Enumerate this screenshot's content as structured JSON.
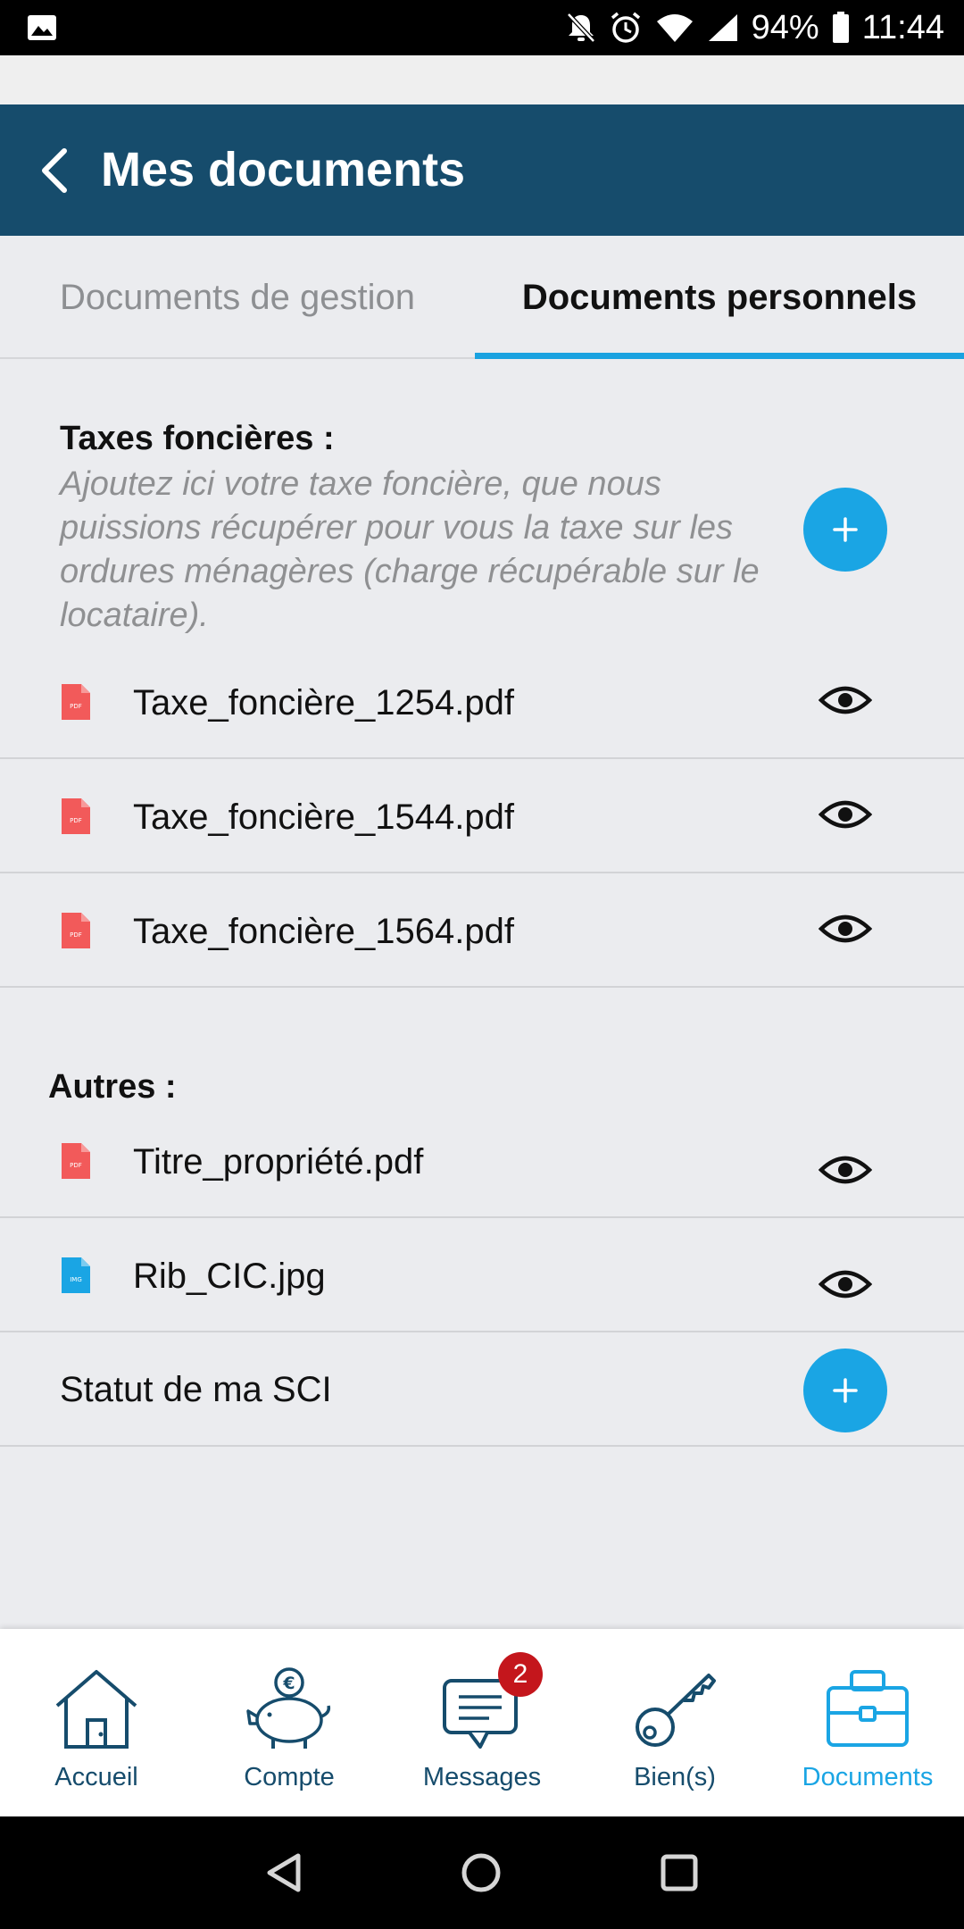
{
  "status_bar": {
    "battery": "94%",
    "time": "11:44"
  },
  "app_bar": {
    "title": "Mes documents"
  },
  "tabs": [
    {
      "label": "Documents de gestion",
      "active": false
    },
    {
      "label": "Documents personnels",
      "active": true
    }
  ],
  "taxes": {
    "title": "Taxes foncières :",
    "description": "Ajoutez ici votre taxe foncière, que nous puissions récupérer pour vous la taxe sur les ordures ménagères (charge récupérable sur le locataire).",
    "files": [
      {
        "name": "Taxe_foncière_1254.pdf",
        "type": "PDF"
      },
      {
        "name": "Taxe_foncière_1544.pdf",
        "type": "PDF"
      },
      {
        "name": "Taxe_foncière_1564.pdf",
        "type": "PDF"
      }
    ]
  },
  "autres": {
    "title": "Autres :",
    "files": [
      {
        "name": "Titre_propriété.pdf",
        "type": "PDF"
      },
      {
        "name": "Rib_CIC.jpg",
        "type": "IMG"
      }
    ],
    "empty_slot": "Statut de ma SCI"
  },
  "bottom_nav": [
    {
      "label": "Accueil",
      "icon": "house-icon",
      "active": false
    },
    {
      "label": "Compte",
      "icon": "piggy-bank-icon",
      "active": false
    },
    {
      "label": "Messages",
      "icon": "messages-icon",
      "active": false,
      "badge": "2"
    },
    {
      "label": "Bien(s)",
      "icon": "key-icon",
      "active": false
    },
    {
      "label": "Documents",
      "icon": "briefcase-icon",
      "active": true
    }
  ],
  "colors": {
    "primary": "#164c6c",
    "accent": "#1aa5e4",
    "pdf": "#f25a5a",
    "img": "#1aa5e4",
    "badge": "#c4161c"
  }
}
